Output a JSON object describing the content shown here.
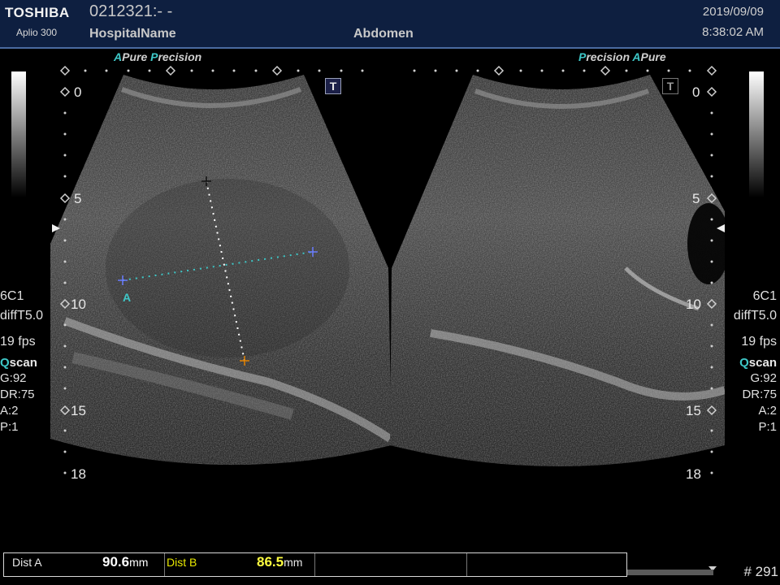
{
  "header": {
    "brand": "TOSHIBA",
    "model": "Aplio 300",
    "patient_id": "0212321:- -",
    "hospital": "HospitalName",
    "exam": "Abdomen",
    "date": "2019/09/09",
    "time": "8:38:02 AM"
  },
  "mode_left": {
    "a": "A",
    "pure": "Pure",
    "p": "P",
    "recision": "recision"
  },
  "mode_right": {
    "p": "P",
    "recision": "recision",
    "a": "A",
    "pure": "Pure"
  },
  "tbox_label": "T",
  "depth_labels": [
    "0",
    "5",
    "10",
    "15",
    "18"
  ],
  "params_left": {
    "probe": "6C1",
    "preset": "diffT5.0",
    "fps": "19 fps",
    "qscan_q": "Q",
    "qscan_rest": "scan",
    "gain": "G:92",
    "dr": "DR:75",
    "a": "A:2",
    "p": "P:1"
  },
  "params_right": {
    "probe": "6C1",
    "preset": "diffT5.0",
    "fps": "19 fps",
    "qscan_q": "Q",
    "qscan_rest": "scan",
    "gain": "G:92",
    "dr": "DR:75",
    "a": "A:2",
    "p": "P:1"
  },
  "caliper_label": "A",
  "measurements": {
    "dist_a_label": "Dist A",
    "dist_a_value": "90.6",
    "dist_a_unit": "mm",
    "dist_b_label": "Dist B",
    "dist_b_value": "86.5",
    "dist_b_unit": "mm"
  },
  "frame_number": "# 291",
  "colors": {
    "header_bg": "#0e1f40",
    "accent_cyan": "#3ec7c7",
    "dist_b": "#e8e800",
    "caliper_b_end": "#e08000"
  }
}
